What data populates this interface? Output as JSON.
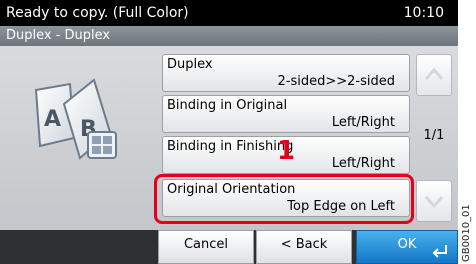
{
  "header": {
    "status": "Ready to copy. (Full Color)",
    "time": "10:10",
    "subtitle": "Duplex - Duplex"
  },
  "options": [
    {
      "label": "Duplex",
      "value": "2-sided>>2-sided"
    },
    {
      "label": "Binding in Original",
      "value": "Left/Right"
    },
    {
      "label": "Binding in Finishing",
      "value": "Left/Right"
    },
    {
      "label": "Original Orientation",
      "value": "Top Edge on Left"
    }
  ],
  "page_indicator": "1/1",
  "step_marker": "1",
  "buttons": {
    "cancel": "Cancel",
    "back": "< Back",
    "ok": "OK"
  },
  "illustration_letters": {
    "a": "A",
    "b": "B"
  },
  "reference_code": "GB0010_01",
  "colors": {
    "highlight": "#e4001b",
    "ok": "#1476c8",
    "header": "#000000"
  }
}
